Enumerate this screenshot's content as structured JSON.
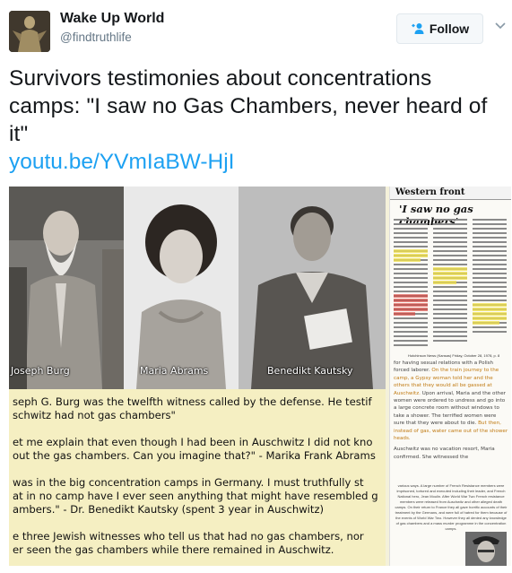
{
  "tweet": {
    "display_name": "Wake Up World",
    "handle": "@findtruthlife",
    "follow_label": "Follow",
    "text": "Survivors testimonies about concentrations camps: \"I saw no Gas Chambers, never heard of it\"",
    "link": "youtu.be/YVmIaBW-HjI"
  },
  "media": {
    "captions": [
      "Joseph Burg",
      "Maria Abrams",
      "Benedikt Kautsky"
    ],
    "quotes": [
      "seph G. Burg was the twelfth witness called by the defense. He testif",
      "schwitz had not gas chambers\"",
      "et me explain that even though I had been in Auschwitz I did not kno",
      "out the gas chambers. Can you imagine that?\" - Marika Frank Abrams",
      "was in the big concentration camps in Germany. I must truthfully st",
      "at in no camp have I ever seen anything that might have resembled g",
      "ambers.\" - Dr. Benedikt Kautsky (spent 3 year in Auschwitz)",
      "e three Jewish witnesses who tell us that had no gas chambers, nor",
      "er seen the gas chambers while there remained in Auschwitz."
    ],
    "article": {
      "section": "Western front",
      "headline": "'I saw no gas chambers'",
      "source": "Hutchinson News (Kansas) Friday, October 28, 1978, p. 8",
      "body_1": "for having sexual relations with a Polish forced laborer. ",
      "body_hl_1": "On the train journey to the camp, a Gypsy woman told her and the others that they would all be gassed at Auschwitz.",
      "body_2": " Upon arrival, Maria and the other women were ordered to undress and go into a large concrete room without windows to take a shower. The terrified women were sure that they were about to die. ",
      "body_hl_2": "But then, instead of gas, water came out of the shower heads.",
      "body_3": "Auschwitz was no vacation resort, Maria confirmed. She witnessed the",
      "body_small": "various ways. A large number of French Resistance members were imprisoned, tortured and executed including their leader, and French National hero, Jean Moulin. After World War Two French resistance members were released from Auschwitz and other alleged death camps. On their return to France they all gave horrific accounts of their treatment by the Germans, and were full of hatred for them because of the events of World War Two. However they all denied any knowledge of gas chambers and a mass murder programme in the concentration camps."
    }
  },
  "colors": {
    "accent": "#1da1f2",
    "text": "#14171a",
    "muted": "#657786",
    "highlight_yellow": "#f5efc2"
  }
}
